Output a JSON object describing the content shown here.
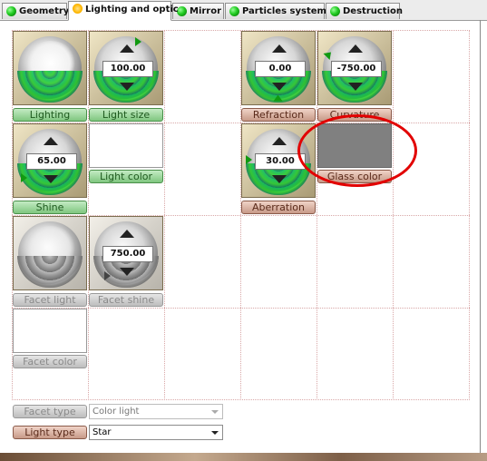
{
  "tabs": [
    {
      "label": "Geometry"
    },
    {
      "label": "Lighting and optic"
    },
    {
      "label": "Mirror"
    },
    {
      "label": "Particles system"
    },
    {
      "label": "Destruction"
    }
  ],
  "controls": {
    "lighting_label": "Lighting",
    "light_size_value": "100.00",
    "light_size_label": "Light size",
    "refraction_value": "0.00",
    "refraction_label": "Refraction",
    "curvature_value": "-750.00",
    "curvature_label": "Curvature",
    "shine_value": "65.00",
    "shine_label": "Shine",
    "light_color_label": "Light color",
    "aberration_value": "30.00",
    "aberration_label": "Aberration",
    "glass_color_label": "Glass color",
    "facet_light_label": "Facet light",
    "facet_shine_value": "750.00",
    "facet_shine_label": "Facet shine",
    "facet_color_label": "Facet color"
  },
  "swatches": {
    "light_color": "#ffffff",
    "glass_color": "#808080",
    "facet_color": "#ffffff"
  },
  "bottom": {
    "facet_type_label": "Facet type",
    "facet_type_value": "Color light",
    "light_type_label": "Light type",
    "light_type_value": "Star"
  },
  "highlight_color": "#e20000"
}
